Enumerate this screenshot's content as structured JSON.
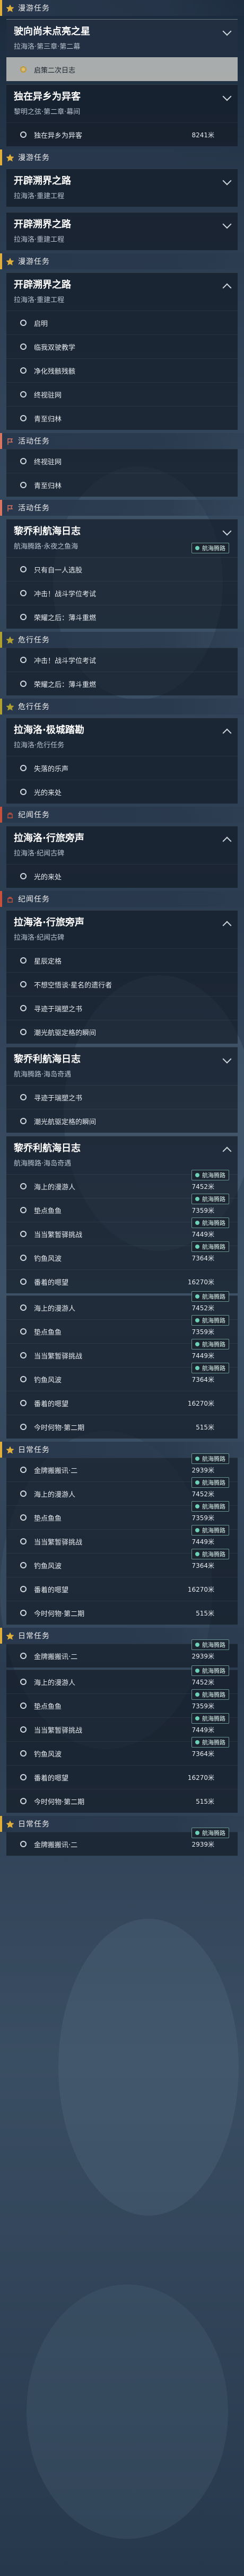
{
  "colors": {
    "cat_daily": "#e0ae3a",
    "cat_weekly": "#e0ae3a",
    "cat_event": "#d97560",
    "cat_wander": "#b0a030",
    "cat_ruin": "#c9503b",
    "badge_border": "#8cc8be"
  },
  "blocks": [
    {
      "k": "cat",
      "color": "#e0ae3a",
      "icon": "star-icon",
      "label": "漫游任务"
    },
    {
      "k": "quest",
      "title": "驶向尚未点亮之星",
      "sub": "拉海洛·第三章·第二幕",
      "hl": true,
      "chev": "down"
    },
    {
      "k": "obj",
      "text": "启策二次日志",
      "sel": true
    },
    {
      "k": "quest",
      "title": "独在异乡为异客",
      "sub": "黎明之弦·第二章·幕间",
      "chev": "down"
    },
    {
      "k": "obj",
      "text": "独在异乡为异客",
      "dist": "8241米"
    },
    {
      "k": "cat",
      "color": "#e0ae3a",
      "icon": "star-icon",
      "label": "漫游任务"
    },
    {
      "k": "quest",
      "title": "开辟溯界之路",
      "sub": "拉海洛·重建工程",
      "chev": "down"
    },
    {
      "k": "gap"
    },
    {
      "k": "quest",
      "title": "开辟溯界之路",
      "sub": "拉海洛·重建工程",
      "chev": "down"
    },
    {
      "k": "cat",
      "color": "#e0ae3a",
      "icon": "star-icon",
      "label": "漫游任务"
    },
    {
      "k": "quest",
      "title": "开辟溯界之路",
      "sub": "拉海洛·重建工程",
      "chev": "up"
    },
    {
      "k": "obj",
      "text": "启明"
    },
    {
      "k": "obj",
      "text": "临我双驶教学"
    },
    {
      "k": "obj",
      "text": "净化残骸残骸"
    },
    {
      "k": "obj",
      "text": "终视驻网"
    },
    {
      "k": "obj",
      "text": "青至归林"
    },
    {
      "k": "cat",
      "color": "#d97560",
      "icon": "flag-icon",
      "label": "活动任务"
    },
    {
      "k": "obj",
      "text": "终视驻网"
    },
    {
      "k": "obj",
      "text": "青至归林"
    },
    {
      "k": "cat",
      "color": "#d97560",
      "icon": "flag-icon",
      "label": "活动任务"
    },
    {
      "k": "quest",
      "title": "黎乔利航海日志",
      "sub": "航海腾路·永夜之鱼海",
      "chev": "down",
      "badge": "航海腾路"
    },
    {
      "k": "obj",
      "text": "只有自一人选股"
    },
    {
      "k": "obj",
      "text": "冲击！战斗学位考试"
    },
    {
      "k": "obj",
      "text": "荣耀之后：薄斗重燃"
    },
    {
      "k": "cat",
      "color": "#b0a030",
      "icon": "star-icon",
      "label": "危行任务"
    },
    {
      "k": "obj",
      "text": "冲击！战斗学位考试"
    },
    {
      "k": "obj",
      "text": "荣耀之后：薄斗重燃"
    },
    {
      "k": "cat",
      "color": "#b0a030",
      "icon": "star-icon",
      "label": "危行任务"
    },
    {
      "k": "quest",
      "title": "拉海洛·极城踏勘",
      "sub": "拉海洛·危行任务",
      "chev": "up"
    },
    {
      "k": "obj",
      "text": "失落的乐声"
    },
    {
      "k": "obj",
      "text": "光的来处"
    },
    {
      "k": "cat",
      "color": "#c9503b",
      "icon": "ruin-icon",
      "label": "纪闻任务"
    },
    {
      "k": "quest",
      "title": "拉海洛·行旅旁声",
      "sub": "拉海洛·纪闻古碑",
      "chev": "up"
    },
    {
      "k": "obj",
      "text": "光的来处"
    },
    {
      "k": "cat",
      "color": "#c9503b",
      "icon": "ruin-icon",
      "label": "纪闻任务"
    },
    {
      "k": "quest",
      "title": "拉海洛·行旅旁声",
      "sub": "拉海洛·纪闻古碑",
      "chev": "up"
    },
    {
      "k": "obj",
      "text": "星辰定格"
    },
    {
      "k": "obj",
      "text": "不想空悟谈·星名的遗行者"
    },
    {
      "k": "obj",
      "text": "寻迹于瑞塑之书"
    },
    {
      "k": "obj",
      "text": "潮光航驱定格的瞬间"
    },
    {
      "k": "quest",
      "title": "黎乔利航海日志",
      "sub": "航海腾路·海岛奇遇",
      "chev": "down"
    },
    {
      "k": "obj",
      "text": "寻迹于瑞塑之书"
    },
    {
      "k": "obj",
      "text": "潮光航驱定格的瞬间"
    },
    {
      "k": "quest",
      "title": "黎乔利航海日志",
      "sub": "航海腾路·海岛奇遇",
      "chev": "up"
    },
    {
      "k": "obj",
      "text": "海上的漫游人",
      "dist": "7452米",
      "badge": "航海腾路"
    },
    {
      "k": "obj",
      "text": "垫点鱼鱼",
      "dist": "7359米",
      "badge": "航海腾路"
    },
    {
      "k": "obj",
      "text": "当当繁暂驿挑战",
      "dist": "7449米",
      "badge": "航海腾路"
    },
    {
      "k": "obj",
      "text": "钓鱼风波",
      "dist": "7364米",
      "badge": "航海腾路"
    },
    {
      "k": "obj",
      "text": "番着的嗯望",
      "dist": "16270米"
    },
    {
      "k": "gap"
    },
    {
      "k": "obj",
      "text": "海上的漫游人",
      "dist": "7452米",
      "badge": "航海腾路"
    },
    {
      "k": "obj",
      "text": "垫点鱼鱼",
      "dist": "7359米",
      "badge": "航海腾路"
    },
    {
      "k": "obj",
      "text": "当当繁暂驿挑战",
      "dist": "7449米",
      "badge": "航海腾路"
    },
    {
      "k": "obj",
      "text": "钓鱼风波",
      "dist": "7364米",
      "badge": "航海腾路"
    },
    {
      "k": "obj",
      "text": "番着的嗯望",
      "dist": "16270米"
    },
    {
      "k": "obj",
      "text": "今时何物·第二期",
      "dist": "515米"
    },
    {
      "k": "cat",
      "color": "#e0ae3a",
      "icon": "star-icon",
      "label": "日常任务"
    },
    {
      "k": "obj",
      "text": "金牌搬搬讯·二",
      "dist": "2939米",
      "badge": "航海腾路"
    },
    {
      "k": "obj",
      "text": "海上的漫游人",
      "dist": "7452米",
      "badge": "航海腾路"
    },
    {
      "k": "obj",
      "text": "垫点鱼鱼",
      "dist": "7359米",
      "badge": "航海腾路"
    },
    {
      "k": "obj",
      "text": "当当繁暂驿挑战",
      "dist": "7449米",
      "badge": "航海腾路"
    },
    {
      "k": "obj",
      "text": "钓鱼风波",
      "dist": "7364米",
      "badge": "航海腾路"
    },
    {
      "k": "obj",
      "text": "番着的嗯望",
      "dist": "16270米"
    },
    {
      "k": "obj",
      "text": "今时何物·第二期",
      "dist": "515米"
    },
    {
      "k": "cat",
      "color": "#e0ae3a",
      "icon": "star-icon",
      "label": "日常任务"
    },
    {
      "k": "obj",
      "text": "金牌搬搬讯·二",
      "dist": "2939米",
      "badge": "航海腾路"
    },
    {
      "k": "gap"
    },
    {
      "k": "obj",
      "text": "海上的漫游人",
      "dist": "7452米",
      "badge": "航海腾路"
    },
    {
      "k": "obj",
      "text": "垫点鱼鱼",
      "dist": "7359米",
      "badge": "航海腾路"
    },
    {
      "k": "obj",
      "text": "当当繁暂驿挑战",
      "dist": "7449米",
      "badge": "航海腾路"
    },
    {
      "k": "obj",
      "text": "钓鱼风波",
      "dist": "7364米",
      "badge": "航海腾路"
    },
    {
      "k": "obj",
      "text": "番着的嗯望",
      "dist": "16270米"
    },
    {
      "k": "obj",
      "text": "今时何物·第二期",
      "dist": "515米"
    },
    {
      "k": "cat",
      "color": "#e0ae3a",
      "icon": "star-icon",
      "label": "日常任务"
    },
    {
      "k": "obj",
      "text": "金牌搬搬讯·二",
      "dist": "2939米",
      "badge": "航海腾路"
    }
  ]
}
